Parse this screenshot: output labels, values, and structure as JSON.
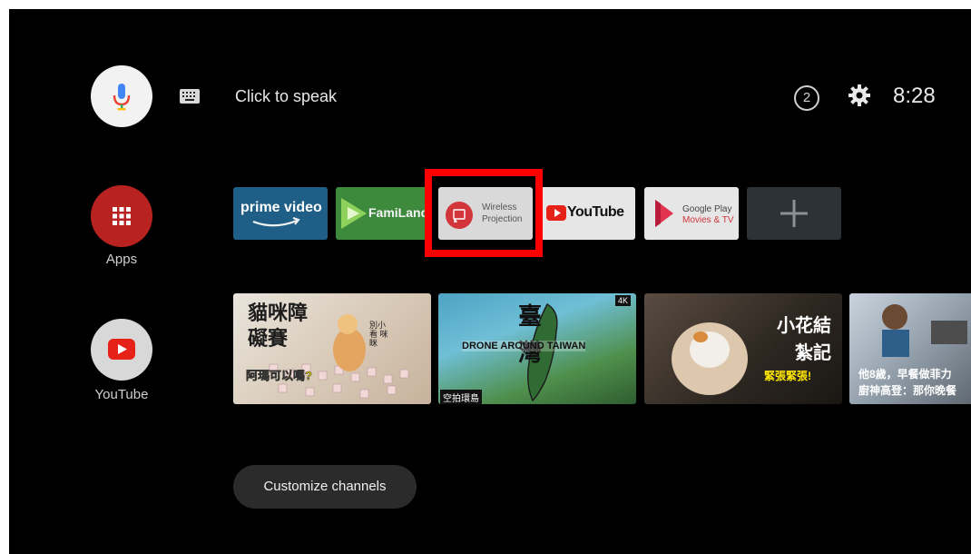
{
  "search": {
    "prompt": "Click to speak"
  },
  "status": {
    "notifications_count": "2",
    "time": "8:28"
  },
  "sidebar": {
    "items": [
      {
        "label": "Apps",
        "icon": "apps-grid-icon"
      },
      {
        "label": "YouTube",
        "icon": "youtube-play-icon"
      }
    ]
  },
  "apps_row": {
    "tiles": [
      {
        "title": "prime video",
        "icon": "prime-video-logo"
      },
      {
        "title": "FamiLand",
        "icon": "familand-logo"
      },
      {
        "title": "Wireless",
        "subtitle": "Projection",
        "icon": "screen-cast-icon"
      },
      {
        "title": "YouTube",
        "icon": "youtube-logo"
      },
      {
        "title": "Google Play",
        "subtitle": "Movies & TV",
        "icon": "google-play-movies-logo"
      },
      {
        "title": "",
        "icon": "add-icon"
      }
    ]
  },
  "channel_row": {
    "thumbnails": [
      {
        "title": "貓咪障礙賽",
        "caption": "阿瑪可以嗎?",
        "note": "別小看 咪眯"
      },
      {
        "title": "臺灣",
        "caption": "DRONE AROUND TAIWAN",
        "badge": "4K",
        "tag": "空拍環島"
      },
      {
        "title": "小花結紮記",
        "caption": "緊張緊張!"
      },
      {
        "title": "他8歲，早餐做菲力",
        "caption": "廚神高登：那你晚餐"
      }
    ]
  },
  "footer": {
    "customize_label": "Customize channels"
  },
  "colors": {
    "background": "#000000",
    "apps_red": "#b82322",
    "youtube_red": "#e62117",
    "highlight": "#ff0000"
  }
}
